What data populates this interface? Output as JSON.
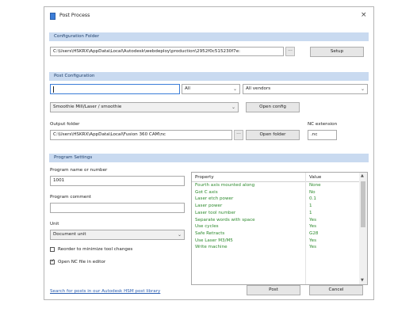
{
  "window": {
    "title": "Post Process",
    "close": "×"
  },
  "config_folder": {
    "header": "Configuration Folder",
    "path": "C:\\Users\\HSKRX\\AppData\\Local\\Autodesk\\webdeploy\\production\\2952f0c515230f7e:",
    "browse": "...",
    "setup_label": "Setup"
  },
  "post_config": {
    "header": "Post Configuration",
    "search_value": "",
    "filter1": "All",
    "filter2": "All vendors",
    "post_select": "Smoothie Mill/Laser / smoothie",
    "open_config_label": "Open config"
  },
  "output": {
    "folder_label": "Output folder",
    "folder_path": "C:\\Users\\HSKRX\\AppData\\Local\\Fusion 360 CAM\\nc",
    "browse": "...",
    "open_folder_label": "Open folder",
    "ext_label": "NC extension",
    "ext_value": ".nc"
  },
  "program": {
    "header": "Program Settings",
    "name_label": "Program name or number",
    "name_value": "1001",
    "comment_label": "Program comment",
    "comment_value": "",
    "unit_label": "Unit",
    "unit_value": "Document unit",
    "reorder_label": "Reorder to minimize tool changes",
    "reorder_checked": false,
    "open_editor_label": "Open NC file in editor",
    "open_editor_checked": true
  },
  "properties": {
    "col_property": "Property",
    "col_value": "Value",
    "rows": [
      {
        "property": "Fourth axis mounted along",
        "value": "None"
      },
      {
        "property": "Got C axis",
        "value": "No"
      },
      {
        "property": "Laser etch power",
        "value": "0.1"
      },
      {
        "property": "Laser power",
        "value": "1"
      },
      {
        "property": "Laser tool number",
        "value": "1"
      },
      {
        "property": "Separate words with space",
        "value": "Yes"
      },
      {
        "property": "Use cycles",
        "value": "Yes"
      },
      {
        "property": "Safe Retracts",
        "value": "G28"
      },
      {
        "property": "Use Laser M3/M5",
        "value": "Yes"
      },
      {
        "property": "Write machine",
        "value": "Yes"
      }
    ]
  },
  "footer": {
    "link": "Search for posts in our Autodesk HSM post library",
    "post_label": "Post",
    "cancel_label": "Cancel"
  },
  "icons": {
    "dropdown": "chevron-down-icon",
    "check": "checkmark-icon"
  }
}
